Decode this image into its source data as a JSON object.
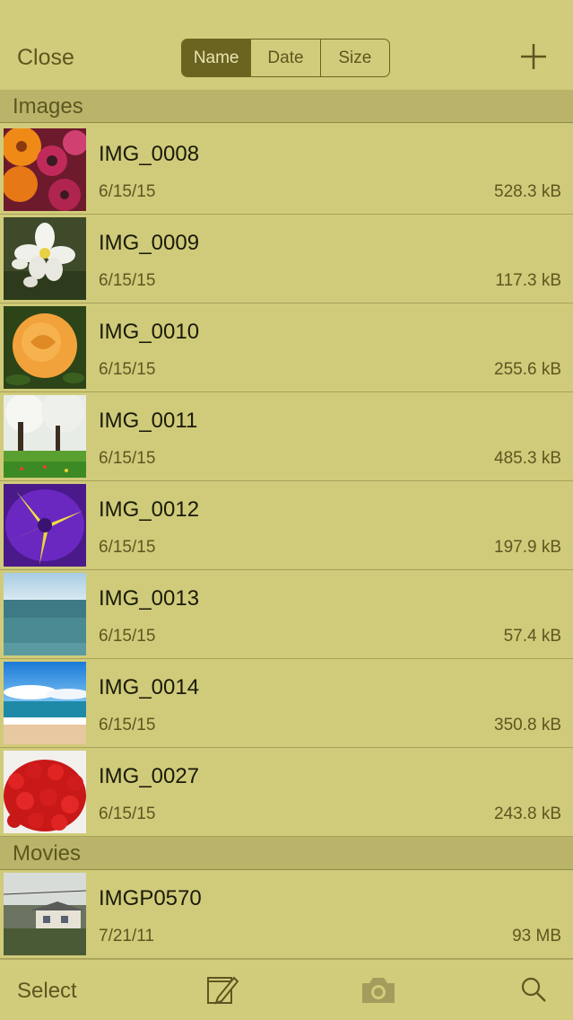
{
  "nav": {
    "close_label": "Close",
    "sort_options": [
      "Name",
      "Date",
      "Size"
    ],
    "active_sort": "Name"
  },
  "sections": [
    {
      "title": "Images",
      "items": [
        {
          "name": "IMG_0008",
          "date": "6/15/15",
          "size": "528.3 kB"
        },
        {
          "name": "IMG_0009",
          "date": "6/15/15",
          "size": "117.3 kB"
        },
        {
          "name": "IMG_0010",
          "date": "6/15/15",
          "size": "255.6 kB"
        },
        {
          "name": "IMG_0011",
          "date": "6/15/15",
          "size": "485.3 kB"
        },
        {
          "name": "IMG_0012",
          "date": "6/15/15",
          "size": "197.9 kB"
        },
        {
          "name": "IMG_0013",
          "date": "6/15/15",
          "size": "57.4 kB"
        },
        {
          "name": "IMG_0014",
          "date": "6/15/15",
          "size": "350.8 kB"
        },
        {
          "name": "IMG_0027",
          "date": "6/15/15",
          "size": "243.8 kB"
        }
      ]
    },
    {
      "title": "Movies",
      "items": [
        {
          "name": "IMGP0570",
          "date": "7/21/11",
          "size": "93 MB"
        }
      ]
    }
  ],
  "toolbar": {
    "select_label": "Select",
    "icons": [
      "edit-icon",
      "camera-icon",
      "search-icon"
    ]
  },
  "colors": {
    "background": "#d0cb7a",
    "accent": "#6a6420",
    "section_header": "#b9b469"
  }
}
